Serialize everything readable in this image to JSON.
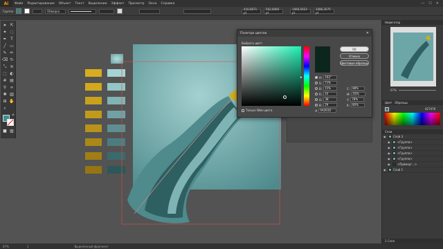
{
  "menubar": {
    "logo": "Ai",
    "items": [
      "Файл",
      "Редактирование",
      "Объект",
      "Текст",
      "Выделение",
      "Эффект",
      "Просмотр",
      "Окно",
      "Справка"
    ]
  },
  "controlbar": {
    "selection_label": "Группа",
    "style_label": "Обводка",
    "x_value": "416,6671 pt",
    "y_value": "562,6066 pt",
    "w_value": "1060,5023 pt",
    "h_value": "1086,3575 pt"
  },
  "dialog": {
    "title": "Палитра цветов",
    "select_color_label": "Выбрать цвет:",
    "ok_label": "OK",
    "cancel_label": "Отмена",
    "swatches_label": "Цветовые образцы",
    "web_only_label": "Только Web-цвета",
    "hsb": [
      {
        "label": "H:",
        "value": "162°"
      },
      {
        "label": "S:",
        "value": "73%"
      },
      {
        "label": "B:",
        "value": "15%"
      }
    ],
    "rgb": [
      {
        "label": "R:",
        "value": "10"
      },
      {
        "label": "G:",
        "value": "38"
      },
      {
        "label": "B:",
        "value": "29"
      }
    ],
    "cmyk": [
      {
        "label": "C:",
        "value": "88%"
      },
      {
        "label": "M:",
        "value": "56%"
      },
      {
        "label": "Y:",
        "value": "78%"
      },
      {
        "label": "K:",
        "value": "80%"
      }
    ],
    "hex_label": "#",
    "hex_value": "0A261D",
    "selected_color": "#0a261d"
  },
  "navigator": {
    "title": "Навигатор",
    "zoom": "67%"
  },
  "color_panel": {
    "tabs": [
      "Цвет",
      "Образцы"
    ],
    "hex": "427476"
  },
  "layers_panel": {
    "title": "Слои",
    "rows": [
      {
        "name": "Слой 3"
      },
      {
        "name": "<Группа>"
      },
      {
        "name": "<Группа>"
      },
      {
        "name": "<Группа>"
      },
      {
        "name": "<Группа>"
      },
      {
        "name": "<Прямоуг...>"
      },
      {
        "name": "Слой 1"
      }
    ],
    "footer": "2 Слоя"
  },
  "statusbar": {
    "zoom": "67%",
    "page": "1",
    "tool": "Выделенный фрагмент"
  },
  "colors": {
    "accent": "#31c5a6",
    "brand": "#ff9a00",
    "gold": "#d4ac20",
    "teal": "#5e9ea0"
  }
}
